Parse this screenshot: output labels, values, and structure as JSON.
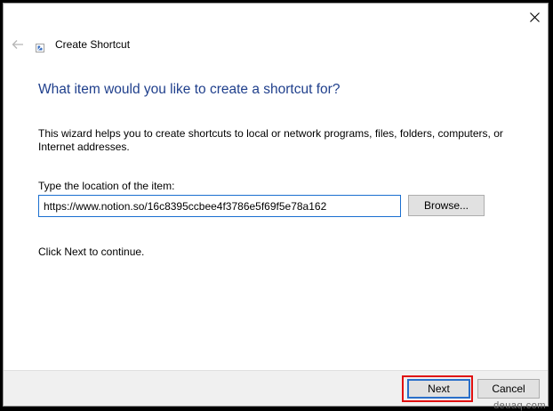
{
  "window": {
    "title": "Create Shortcut",
    "close_icon": "close-icon",
    "back_icon": "back-arrow-icon",
    "title_icon": "shortcut-icon"
  },
  "main": {
    "heading": "What item would you like to create a shortcut for?",
    "description": "This wizard helps you to create shortcuts to local or network programs, files, folders, computers, or Internet addresses.",
    "location_label": "Type the location of the item:",
    "location_value": "https://www.notion.so/16c8395ccbee4f3786e5f69f5e78a162",
    "browse_label": "Browse...",
    "continue_text": "Click Next to continue."
  },
  "footer": {
    "next_label": "Next",
    "cancel_label": "Cancel"
  },
  "watermark": "deuaq.com",
  "colors": {
    "heading": "#1f3f8c",
    "highlight": "#e01010",
    "input_border": "#1a6fd0"
  }
}
